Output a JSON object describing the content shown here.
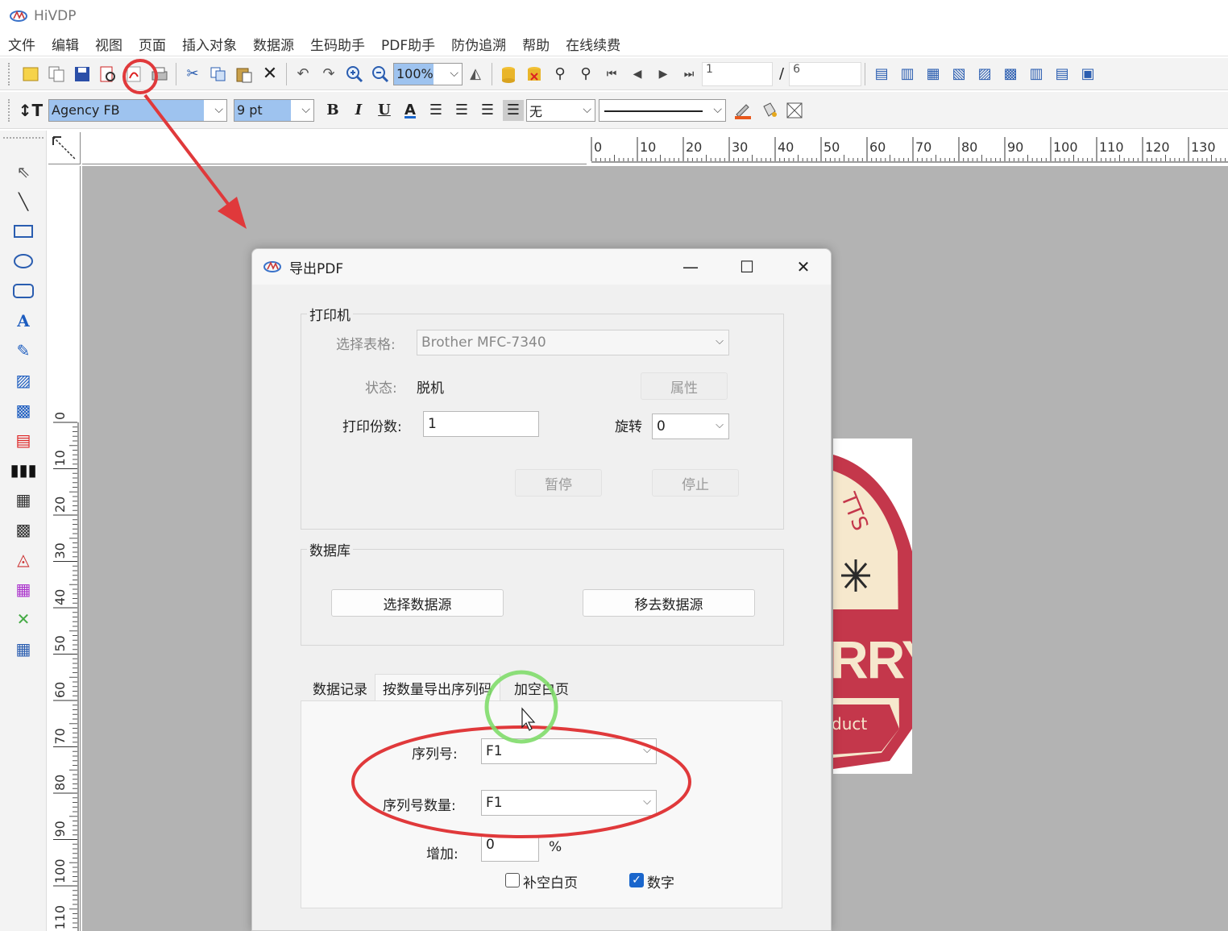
{
  "app": {
    "title": "HiVDP"
  },
  "menu": [
    "文件",
    "编辑",
    "视图",
    "页面",
    "插入对象",
    "数据源",
    "生码助手",
    "PDF助手",
    "防伪追溯",
    "帮助",
    "在线续费"
  ],
  "toolbar1": {
    "zoom": "100%",
    "current_page": "1",
    "total_pages": "6",
    "page_sep": "/"
  },
  "toolbar2": {
    "font_name": "Agency FB",
    "font_size": "9 pt",
    "bold": "B",
    "italic": "I",
    "underline": "U",
    "font_color": "A",
    "border_style": "无"
  },
  "ruler": {
    "top_ticks": [
      "0",
      "10",
      "20",
      "30",
      "40",
      "50",
      "60",
      "70",
      "80",
      "90",
      "100",
      "110",
      "120",
      "130"
    ],
    "left_ticks": [
      "0",
      "10",
      "20",
      "30",
      "40",
      "50",
      "60",
      "70",
      "80",
      "90",
      "100",
      "110"
    ]
  },
  "dialog": {
    "title": "导出PDF",
    "printer_group": {
      "legend": "打印机",
      "select_label": "选择表格:",
      "select_value": "Brother MFC-7340",
      "status_label": "状态:",
      "status_value": "脱机",
      "properties_button": "属性",
      "copies_label": "打印份数:",
      "copies_value": "1",
      "rotate_label": "旋转",
      "rotate_value": "0",
      "pause_button": "暂停",
      "stop_button": "停止"
    },
    "database_group": {
      "legend": "数据库",
      "select_source_button": "选择数据源",
      "remove_source_button": "移去数据源"
    },
    "tabs": [
      "数据记录",
      "按数量导出序列码",
      "加空白页"
    ],
    "active_tab": "按数量导出序列码",
    "serial": {
      "serial_label": "序列号:",
      "serial_value": "F1",
      "serial_count_label": "序列号数量:",
      "serial_count_value": "F1",
      "increase_label": "增加:",
      "increase_value": "0",
      "percent": "%",
      "blank_page_label": "补空白页",
      "blank_page_checked": false,
      "number_label": "数字",
      "number_checked": true
    }
  },
  "label_preview": {
    "text_arc": "TTS",
    "big_text": "RRY",
    "small_text": "duct"
  },
  "colors": {
    "annotation_red": "#e0393b",
    "annotation_green": "#7fdc6a",
    "label_red": "#c4374b",
    "label_cream": "#f6e8cd"
  }
}
